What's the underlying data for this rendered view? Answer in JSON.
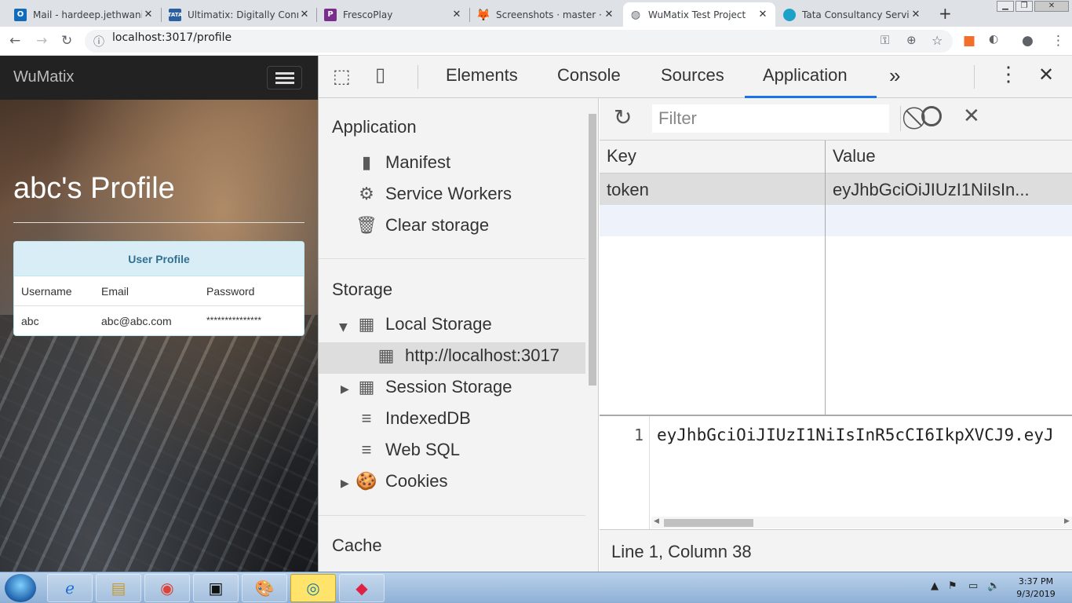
{
  "browser": {
    "tabs": [
      {
        "title": "Mail - hardeep.jethwani@",
        "favicon": "outlook-icon",
        "color": "#0f6cbd",
        "active": false
      },
      {
        "title": "Ultimatix: Digitally Conne",
        "favicon": "tata-icon",
        "color": "#2b5fa3",
        "active": false
      },
      {
        "title": "FrescoPlay",
        "favicon": "frescoplay-icon",
        "color": "#7b2d8e",
        "active": false
      },
      {
        "title": "Screenshots · master · Ha",
        "favicon": "gitlab-icon",
        "color": "#e24329",
        "active": false
      },
      {
        "title": "WuMatix Test Project",
        "favicon": "globe-icon",
        "color": "#5f6368",
        "active": true
      },
      {
        "title": "Tata Consultancy Service",
        "favicon": "tcs-icon",
        "color": "#1da1c8",
        "active": false
      }
    ],
    "url": "localhost:3017/profile"
  },
  "webpage": {
    "brand": "WuMatix",
    "profile_title": "abc's Profile",
    "card_title": "User Profile",
    "columns": [
      "Username",
      "Email",
      "Password"
    ],
    "row": [
      "abc",
      "abc@abc.com",
      "***************"
    ]
  },
  "devtools": {
    "tabs": [
      "Elements",
      "Console",
      "Sources",
      "Application"
    ],
    "active_tab": "Application",
    "more": "»",
    "sidebar": {
      "application_header": "Application",
      "application_items": [
        "Manifest",
        "Service Workers",
        "Clear storage"
      ],
      "storage_header": "Storage",
      "storage_items": {
        "local_storage": "Local Storage",
        "local_origin": "http://localhost:3017",
        "session_storage": "Session Storage",
        "indexeddb": "IndexedDB",
        "websql": "Web SQL",
        "cookies": "Cookies"
      },
      "cache_header": "Cache"
    },
    "filter_placeholder": "Filter",
    "table": {
      "headers": [
        "Key",
        "Value"
      ],
      "rows": [
        {
          "key": "token",
          "value": "eyJhbGciOiJIUzI1NiIsIn..."
        }
      ]
    },
    "editor": {
      "line_number": "1",
      "text": "eyJhbGciOiJIUzI1NiIsInR5cCI6IkpXVCJ9.eyJ"
    },
    "status": "Line 1, Column 38"
  },
  "taskbar": {
    "time": "3:37 PM",
    "date": "9/3/2019"
  }
}
